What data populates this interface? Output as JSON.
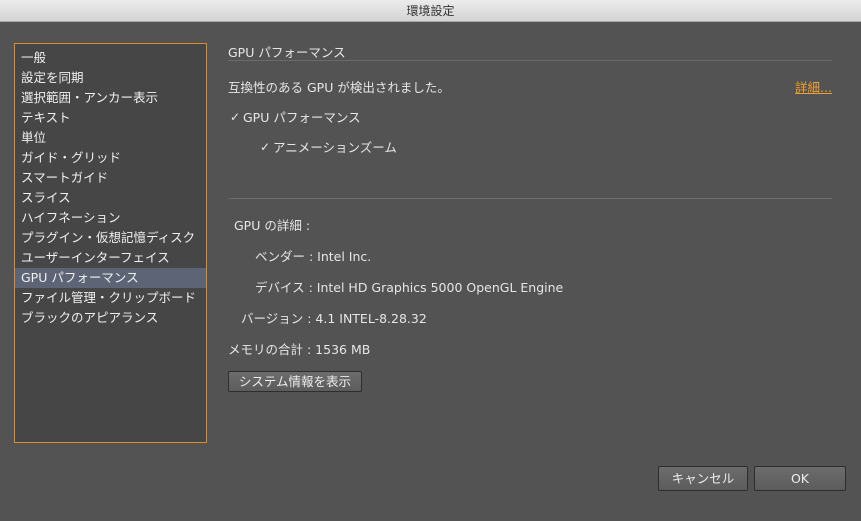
{
  "window": {
    "title": "環境設定"
  },
  "sidebar": {
    "items": [
      {
        "label": "一般"
      },
      {
        "label": "設定を同期"
      },
      {
        "label": "選択範囲・アンカー表示"
      },
      {
        "label": "テキスト"
      },
      {
        "label": "単位"
      },
      {
        "label": "ガイド・グリッド"
      },
      {
        "label": "スマートガイド"
      },
      {
        "label": "スライス"
      },
      {
        "label": "ハイフネーション"
      },
      {
        "label": "プラグイン・仮想記憶ディスク"
      },
      {
        "label": "ユーザーインターフェイス"
      },
      {
        "label": "GPU パフォーマンス"
      },
      {
        "label": "ファイル管理・クリップボード"
      },
      {
        "label": "ブラックのアピアランス"
      }
    ],
    "selected_index": 11
  },
  "main": {
    "section_title": "GPU パフォーマンス",
    "compat_message": "互換性のある GPU が検出されました。",
    "details_link": "詳細...",
    "gpu_performance_checkbox": {
      "label": "GPU パフォーマンス",
      "checked": true
    },
    "animation_zoom_checkbox": {
      "label": "アニメーションズーム",
      "checked": true
    },
    "gpu_details": {
      "heading": "GPU の詳細 :",
      "vendor": "ベンダー : Intel Inc.",
      "device": "デバイス : Intel HD Graphics 5000 OpenGL Engine",
      "version": "バージョン : 4.1 INTEL-8.28.32",
      "memory": "メモリの合計 : 1536 MB"
    },
    "system_info_button": "システム情報を表示"
  },
  "footer": {
    "cancel_label": "キャンセル",
    "ok_label": "OK"
  },
  "colors": {
    "background": "#535353",
    "accent_orange": "#e08a28",
    "selection": "#5d6475"
  }
}
